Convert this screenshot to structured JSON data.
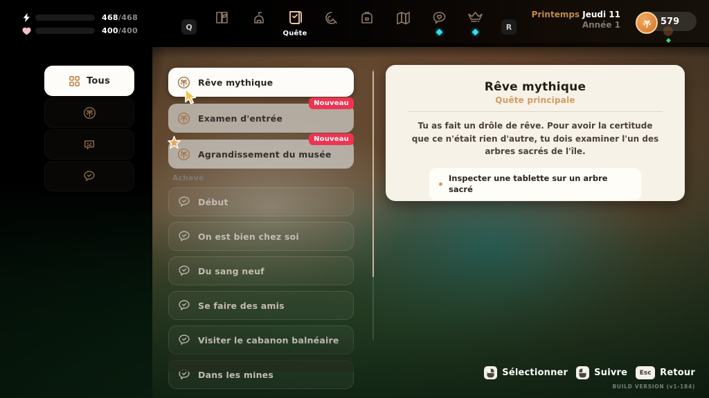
{
  "topbar": {
    "stats": [
      {
        "icon": "lightning-icon",
        "current": "468",
        "max": "468",
        "sep": "/",
        "color": "#38d6ee"
      },
      {
        "icon": "heart-icon",
        "current": "400",
        "max": "400",
        "sep": "/",
        "color": "#a9ed5a"
      }
    ],
    "hotkey_left": "Q",
    "hotkey_right": "R",
    "nav": [
      {
        "id": "journal",
        "icon": "book-leaf-icon",
        "label": "",
        "dot": false
      },
      {
        "id": "buildings",
        "icon": "building-icon",
        "label": "",
        "dot": false
      },
      {
        "id": "quests",
        "icon": "scroll-check-icon",
        "label": "Quête",
        "dot": false,
        "active": true
      },
      {
        "id": "skills",
        "icon": "tool-icon",
        "label": "",
        "dot": false
      },
      {
        "id": "inventory",
        "icon": "backpack-icon",
        "label": "",
        "dot": false
      },
      {
        "id": "map",
        "icon": "map-icon",
        "label": "",
        "dot": false
      },
      {
        "id": "relationships",
        "icon": "heart-chat-icon",
        "label": "",
        "dot": true
      },
      {
        "id": "rank",
        "icon": "crown-icon",
        "label": "",
        "dot": true
      }
    ],
    "date": {
      "season": "Printemps",
      "day": "Jeudi 11",
      "year": "Année 1"
    },
    "currency": {
      "icon": "coin-plant-icon",
      "amount": "579"
    }
  },
  "filters": [
    {
      "id": "all",
      "icon": "grid-icon",
      "label": "Tous",
      "active": true
    },
    {
      "id": "main",
      "icon": "plant-circle-icon",
      "label": "",
      "active": false
    },
    {
      "id": "bulletin",
      "icon": "board-icon",
      "label": "",
      "active": false
    },
    {
      "id": "side",
      "icon": "chat-check-icon",
      "label": "",
      "active": false
    }
  ],
  "quest_list": {
    "active": [
      {
        "title": "Rêve mythique",
        "icon": "plant-circle-icon",
        "state": "selected",
        "badge": ""
      },
      {
        "title": "Examen d'entrée",
        "icon": "plant-circle-icon",
        "state": "pending",
        "badge": "Nouveau"
      },
      {
        "title": "Agrandissement du musée",
        "icon": "plant-circle-icon",
        "state": "pending",
        "badge": "Nouveau"
      }
    ],
    "completed_header": "Achevé",
    "completed": [
      {
        "title": "Début",
        "icon": "chat-check-icon"
      },
      {
        "title": "On est bien chez soi",
        "icon": "chat-check-icon"
      },
      {
        "title": "Du sang neuf",
        "icon": "chat-check-icon"
      },
      {
        "title": "Se faire des amis",
        "icon": "chat-check-icon"
      },
      {
        "title": "Visiter le cabanon balnéaire",
        "icon": "chat-check-icon"
      },
      {
        "title": "Dans les mines",
        "icon": "chat-check-icon"
      }
    ]
  },
  "detail": {
    "title": "Rêve mythique",
    "subtitle": "Quête principale",
    "description": "Tu as fait un drôle de rêve. Pour avoir la certitude que ce n'était rien d'autre, tu dois examiner l'un des arbres sacrés de l'île.",
    "objectives": [
      {
        "text": "Inspecter une tablette sur un arbre sacré"
      }
    ]
  },
  "footer": {
    "hints": [
      {
        "key": "mouse-left",
        "glyph": "",
        "label": "Sélectionner"
      },
      {
        "key": "mouse-right",
        "glyph": "",
        "label": "Suivre"
      },
      {
        "key": "esc",
        "glyph": "Esc",
        "label": "Retour"
      }
    ],
    "build": "BUILD VERSION  (v1-184)"
  },
  "colors": {
    "accent": "#d59a5e",
    "badge_new": "#ef3352",
    "panel": "#f7f2e7",
    "energy": "#38d6ee",
    "health": "#a9ed5a",
    "nav_dot": "#2ee0f2"
  }
}
